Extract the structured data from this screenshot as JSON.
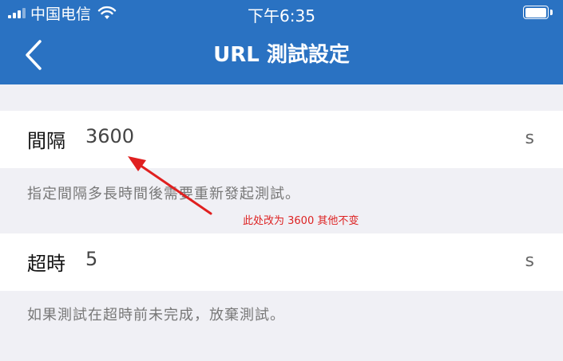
{
  "status_bar": {
    "carrier": "中国电信",
    "time": "下午6:35",
    "icons": [
      "signal-icon",
      "wifi-icon",
      "battery-icon"
    ]
  },
  "nav": {
    "back_icon": "chevron-left-icon",
    "title": "URL 測試設定"
  },
  "settings": [
    {
      "label": "間隔",
      "value": "3600",
      "unit": "s",
      "hint": "指定間隔多長時間後需要重新發起測試。"
    },
    {
      "label": "超時",
      "value": "5",
      "unit": "s",
      "hint": "如果測試在超時前未完成，放棄測試。"
    }
  ],
  "annotation": {
    "text": "此处改为 3600 其他不变",
    "color": "#dd2222"
  },
  "colors": {
    "accent": "#2a72c2",
    "background": "#f0f0f5",
    "row_bg": "#ffffff"
  }
}
